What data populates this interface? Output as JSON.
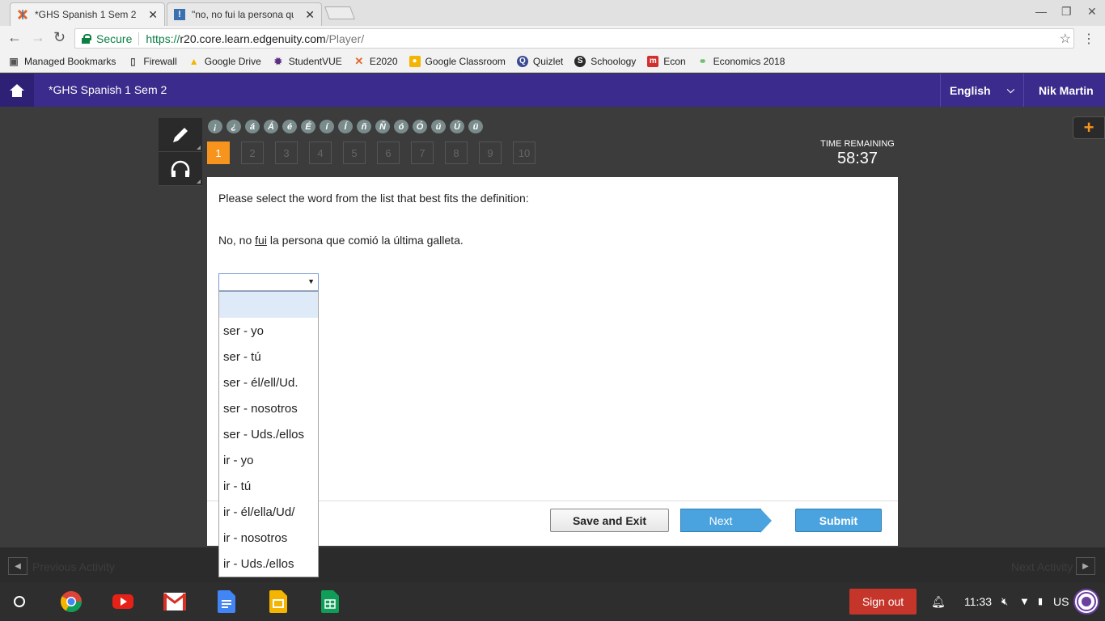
{
  "browser": {
    "tabs": [
      {
        "title": "*GHS Spanish 1 Sem 2 -",
        "active": true
      },
      {
        "title": "\"no, no fui la persona qu",
        "active": false
      }
    ],
    "address": {
      "secure_label": "Secure",
      "scheme": "https://",
      "host": "r20.core.learn.edgenuity.com",
      "path": "/Player/"
    },
    "bookmarks": [
      {
        "label": "Managed Bookmarks",
        "icon": "folder-icon"
      },
      {
        "label": "Firewall",
        "icon": "page-icon"
      },
      {
        "label": "Google Drive",
        "icon": "drive-icon"
      },
      {
        "label": "StudentVUE",
        "icon": "studentvue-icon"
      },
      {
        "label": "E2020",
        "icon": "edgenuity-icon"
      },
      {
        "label": "Google Classroom",
        "icon": "classroom-icon"
      },
      {
        "label": "Quizlet",
        "icon": "quizlet-icon"
      },
      {
        "label": "Schoology",
        "icon": "schoology-icon"
      },
      {
        "label": "Econ",
        "icon": "econ-icon"
      },
      {
        "label": "Economics 2018",
        "icon": "bone-icon"
      }
    ]
  },
  "header": {
    "course": "*GHS Spanish 1 Sem 2",
    "language": "English",
    "user": "Nik Martin"
  },
  "player": {
    "accents": [
      "¡",
      "¿",
      "á",
      "Á",
      "é",
      "É",
      "í",
      "Í",
      "ñ",
      "Ñ",
      "ó",
      "Ó",
      "ú",
      "Ú",
      "ü"
    ],
    "questions": [
      "1",
      "2",
      "3",
      "4",
      "5",
      "6",
      "7",
      "8",
      "9",
      "10"
    ],
    "active_question": "1",
    "timer_label": "TIME REMAINING",
    "timer_value": "58:37",
    "prompt": "Please select the word from the list that best fits the definition:",
    "sentence_before": "No, no ",
    "sentence_target": "fui",
    "sentence_after": " la persona que comió la última galleta.",
    "select_value": "",
    "options": [
      "",
      "ser - yo",
      "ser - tú",
      "ser - él/ell/Ud.",
      "ser - nosotros",
      "ser - Uds./ellos",
      "ir - yo",
      "ir - tú",
      "ir - él/ella/Ud/",
      "ir - nosotros",
      "ir - Uds./ellos"
    ],
    "buttons": {
      "save": "Save and Exit",
      "next": "Next",
      "submit": "Submit"
    },
    "prev_activity": "Previous Activity",
    "next_activity": "Next Activity"
  },
  "shelf": {
    "signout": "Sign out",
    "time": "11:33",
    "locale": "US"
  },
  "colors": {
    "header_purple": "#3a2b8c",
    "accent_orange": "#f7941d",
    "button_blue": "#4aa3df"
  }
}
